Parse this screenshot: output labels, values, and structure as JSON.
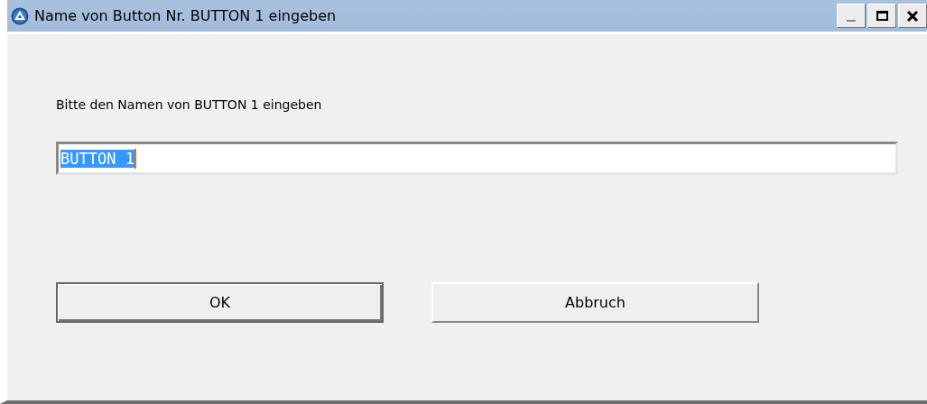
{
  "window": {
    "title": "Name von Button Nr. BUTTON 1 eingeben"
  },
  "prompt": "Bitte den Namen von BUTTON 1 eingeben",
  "field": {
    "value": "BUTTON 1",
    "selected": true
  },
  "buttons": [
    {
      "label": "OK",
      "default": true
    },
    {
      "label": "Abbruch",
      "default": false
    }
  ]
}
